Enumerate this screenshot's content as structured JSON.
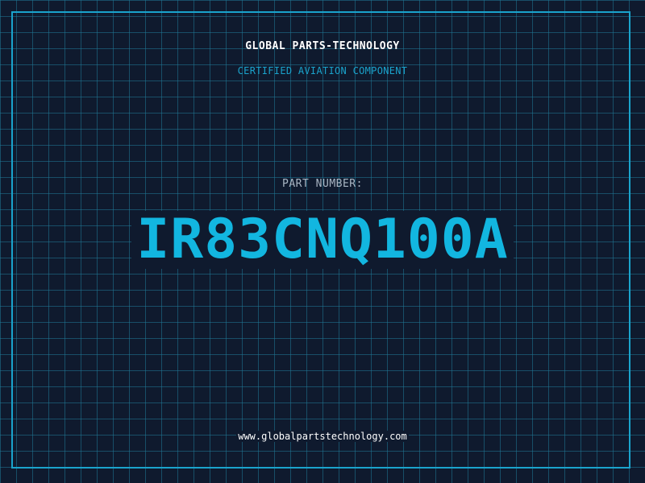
{
  "header": {
    "company": "GLOBAL PARTS-TECHNOLOGY",
    "subtitle": "CERTIFIED AVIATION COMPONENT"
  },
  "part": {
    "label": "PART NUMBER:",
    "number": "IR83CNQ100A"
  },
  "footer": {
    "url": "www.globalpartstechnology.com"
  },
  "colors": {
    "background": "#0f1a2e",
    "accent": "#1aa3cc",
    "part_number": "#12b6e0",
    "text": "#ffffff",
    "muted": "#a9b6c4"
  }
}
